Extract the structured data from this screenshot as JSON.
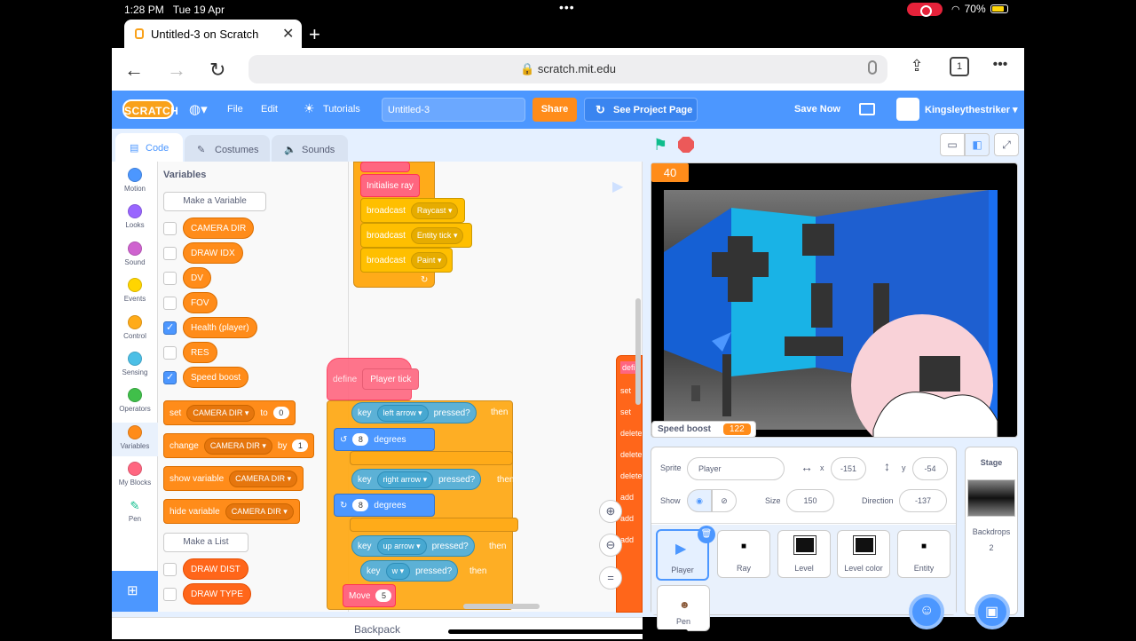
{
  "status": {
    "time": "1:28 PM",
    "date": "Tue 19 Apr",
    "battery": "70%"
  },
  "browser": {
    "tab_title": "Untitled-3 on Scratch",
    "url": "scratch.mit.edu",
    "tabs_count": "1"
  },
  "menu": {
    "logo": "SCRATCH",
    "file": "File",
    "edit": "Edit",
    "tutorials": "Tutorials",
    "project_title": "Untitled-3",
    "share": "Share",
    "see_project": "See Project Page",
    "save_now": "Save Now",
    "username": "Kingsleythestriker"
  },
  "editor_tabs": {
    "code": "Code",
    "costumes": "Costumes",
    "sounds": "Sounds"
  },
  "categories": [
    {
      "label": "Motion",
      "color": "#4c97ff"
    },
    {
      "label": "Looks",
      "color": "#9966ff"
    },
    {
      "label": "Sound",
      "color": "#cf63cf"
    },
    {
      "label": "Events",
      "color": "#ffd500"
    },
    {
      "label": "Control",
      "color": "#ffab19"
    },
    {
      "label": "Sensing",
      "color": "#4cbfe6"
    },
    {
      "label": "Operators",
      "color": "#40bf4a"
    },
    {
      "label": "Variables",
      "color": "#ff8c1a"
    },
    {
      "label": "My Blocks",
      "color": "#ff6680"
    },
    {
      "label": "Pen",
      "color": "#0fbd8c"
    }
  ],
  "palette": {
    "heading": "Variables",
    "make_variable": "Make a Variable",
    "variables": [
      "CAMERA DIR",
      "DRAW IDX",
      "DV",
      "FOV",
      "Health (player)",
      "RES",
      "Speed boost"
    ],
    "checked": [
      false,
      false,
      false,
      false,
      true,
      false,
      true
    ],
    "set_block": {
      "word": "set",
      "var": "CAMERA DIR",
      "to": "to",
      "value": "0"
    },
    "change_block": {
      "word": "change",
      "var": "CAMERA DIR",
      "by": "by",
      "value": "1"
    },
    "show_block": {
      "word": "show variable",
      "var": "CAMERA DIR"
    },
    "hide_block": {
      "word": "hide variable",
      "var": "CAMERA DIR"
    },
    "make_list": "Make a List",
    "lists": [
      "DRAW DIST",
      "DRAW TYPE"
    ]
  },
  "scripts": {
    "init_ray": "Initialise ray",
    "broadcast": "broadcast",
    "raycast": "Raycast",
    "entity_tick": "Entity tick",
    "paint": "Paint",
    "define": "define",
    "player_tick": "Player tick",
    "key": "key",
    "pressed": "pressed?",
    "then": "then",
    "left_arrow": "left arrow",
    "right_arrow": "right arrow",
    "up_arrow": "up arrow",
    "w": "w",
    "turn_value": "8",
    "degrees": "degrees",
    "move": "Move",
    "move_value": "5",
    "right_stack": [
      "defi",
      "set",
      "set",
      "delete",
      "delete",
      "delete",
      "add",
      "add",
      "add"
    ]
  },
  "backpack": "Backpack",
  "stage": {
    "score_monitor": "40",
    "speed_boost_label": "Speed boost",
    "speed_boost_value": "122"
  },
  "sprite_info": {
    "sprite_label": "Sprite",
    "sprite_name": "Player",
    "x_label": "x",
    "x": "-151",
    "y_label": "y",
    "y": "-54",
    "show_label": "Show",
    "size_label": "Size",
    "size": "150",
    "direction_label": "Direction",
    "direction": "-137"
  },
  "sprites": [
    "Player",
    "Ray",
    "Level",
    "Level color",
    "Entity",
    "Pen"
  ],
  "stage_panel": {
    "title": "Stage",
    "backdrops_label": "Backdrops",
    "backdrops_count": "2"
  }
}
